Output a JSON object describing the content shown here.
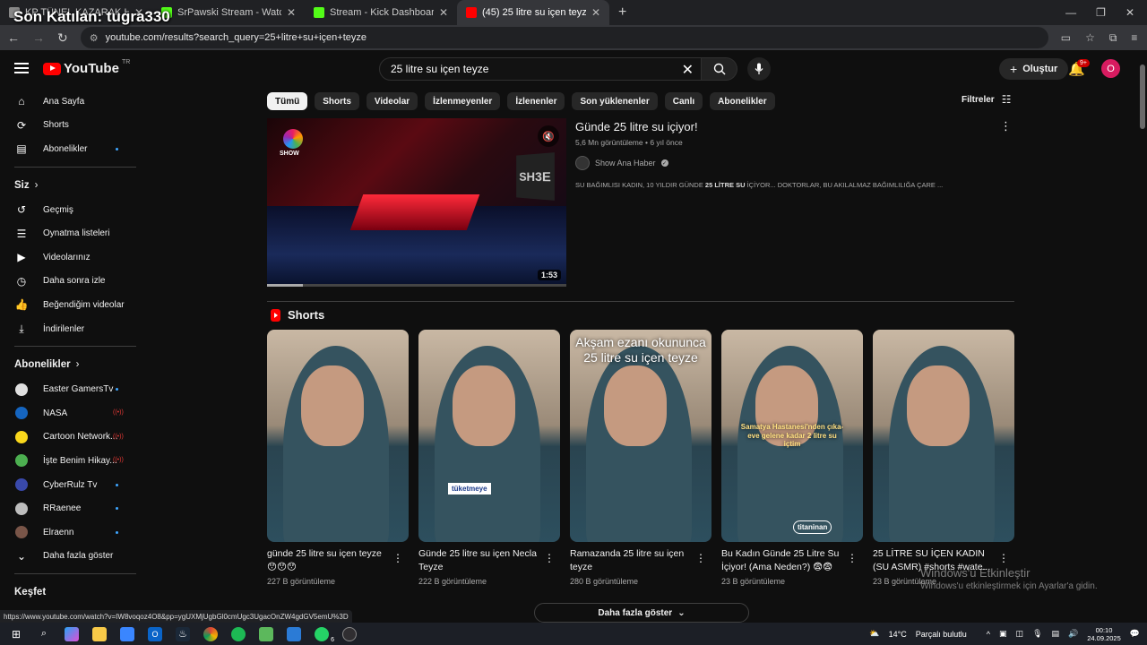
{
  "overlay_text": "Son Katılan: tugra330",
  "browser": {
    "tabs": [
      {
        "label": "KP TÜNEL KAZARAK HAPİSH",
        "color": "#888888",
        "active": false
      },
      {
        "label": "SrPawski Stream - Watch Live o",
        "color": "#53fc18",
        "active": false
      },
      {
        "label": "Stream - Kick Dashboard",
        "color": "#53fc18",
        "active": false
      },
      {
        "label": "(45) 25 litre su içen teyze - YouT",
        "color": "#ff0000",
        "active": true
      }
    ],
    "url": "youtube.com/results?search_query=25+litre+su+içen+teyze"
  },
  "header": {
    "logo_text": "YouTube",
    "logo_region": "TR",
    "search_value": "25 litre su içen teyze",
    "create_label": "Oluştur",
    "notif_badge": "9+",
    "avatar_letter": "O"
  },
  "sidebar": {
    "main": [
      {
        "label": "Ana Sayfa",
        "icon": "⌂"
      },
      {
        "label": "Shorts",
        "icon": "⟳"
      },
      {
        "label": "Abonelikler",
        "icon": "▤"
      }
    ],
    "you_heading": "Siz",
    "you": [
      {
        "label": "Geçmiş",
        "icon": "↺"
      },
      {
        "label": "Oynatma listeleri",
        "icon": "☰"
      },
      {
        "label": "Videolarınız",
        "icon": "▶"
      },
      {
        "label": "Daha sonra izle",
        "icon": "◷"
      },
      {
        "label": "Beğendiğim videolar",
        "icon": "👍"
      },
      {
        "label": "İndirilenler",
        "icon": "⤓"
      }
    ],
    "subs_heading": "Abonelikler",
    "subs": [
      {
        "label": "Easter GamersTv",
        "color": "#e0e0e0",
        "status": "dot"
      },
      {
        "label": "NASA",
        "color": "#1565c0",
        "status": "live"
      },
      {
        "label": "Cartoon Network...",
        "color": "#f9d71c",
        "status": "live"
      },
      {
        "label": "İşte Benim Hikay...",
        "color": "#4caf50",
        "status": "live"
      },
      {
        "label": "CyberRulz Tv",
        "color": "#3949ab",
        "status": "dot"
      },
      {
        "label": "RRaenee",
        "color": "#bdbdbd",
        "status": "dot"
      },
      {
        "label": "Elraenn",
        "color": "#795548",
        "status": "dot"
      }
    ],
    "show_more_label": "Daha fazla göster",
    "explore_heading": "Keşfet",
    "live_icon": "((•))"
  },
  "chips": [
    "Tümü",
    "Shorts",
    "Videolar",
    "İzlenmeyenler",
    "İzlenenler",
    "Son yüklenenler",
    "Canlı",
    "Abonelikler"
  ],
  "filters_label": "Filtreler",
  "video": {
    "title": "Günde 25 litre su içiyor!",
    "views": "5,6 Mn görüntüleme",
    "age": "6 yıl önce",
    "channel": "Show Ana Haber",
    "desc_a": "SU BAĞIMLISI KADIN, 10 YILDIR GÜNDE ",
    "desc_b": "25 LİTRE SU",
    "desc_c": " İÇİYOR... DOKTORLAR, BU AKILALMAZ BAĞIMLILIĞA ÇARE ...",
    "duration": "1:53",
    "progress": 0.12,
    "thumb_logo_text": "SHOW",
    "sign_text": "SH3E"
  },
  "shorts_heading": "Shorts",
  "shorts": [
    {
      "title": "günde 25 litre su içen teyze 😯😯😯",
      "views": "227 B görüntüleme"
    },
    {
      "title": "Günde 25 litre su içen Necla Teyze",
      "views": "222 B görüntüleme",
      "tag": "tüketmeye"
    },
    {
      "title": "Ramazanda 25 litre su içen teyze",
      "views": "280 B görüntüleme",
      "caption": "Akşam ezanı okununca 25 litre su içen teyze"
    },
    {
      "title": "Bu Kadın Günde 25 Litre Su İçiyor! (Ama Neden?) 😨😨",
      "views": "23 B görüntüleme",
      "caption": "Samatya Hastanesi'nden çıka- eve gelene kadar 2 litre su içtim",
      "tag": "titaninan"
    },
    {
      "title": "25 LİTRE SU İÇEN KADIN (SU ASMR) #shorts #wate...",
      "views": "23 B görüntüleme"
    }
  ],
  "show_more_button": "Daha fazla göster",
  "windows_activation": {
    "line1": "Windows'u Etkinleştir",
    "line2": "Windows'u etkinleştirmek için Ayarlar'a gidin."
  },
  "status_url": "https://www.youtube.com/watch?v=IW8voqoz4O8&pp=ygUXMjUgbGl0cmUgc3UgacOnZW4gdGV5emU%3D",
  "taskbar": {
    "weather_temp": "14°C",
    "weather_desc": "Parçalı bulutlu",
    "time": "00:10",
    "date": "24.09.2025",
    "whatsapp_badge": "6"
  }
}
